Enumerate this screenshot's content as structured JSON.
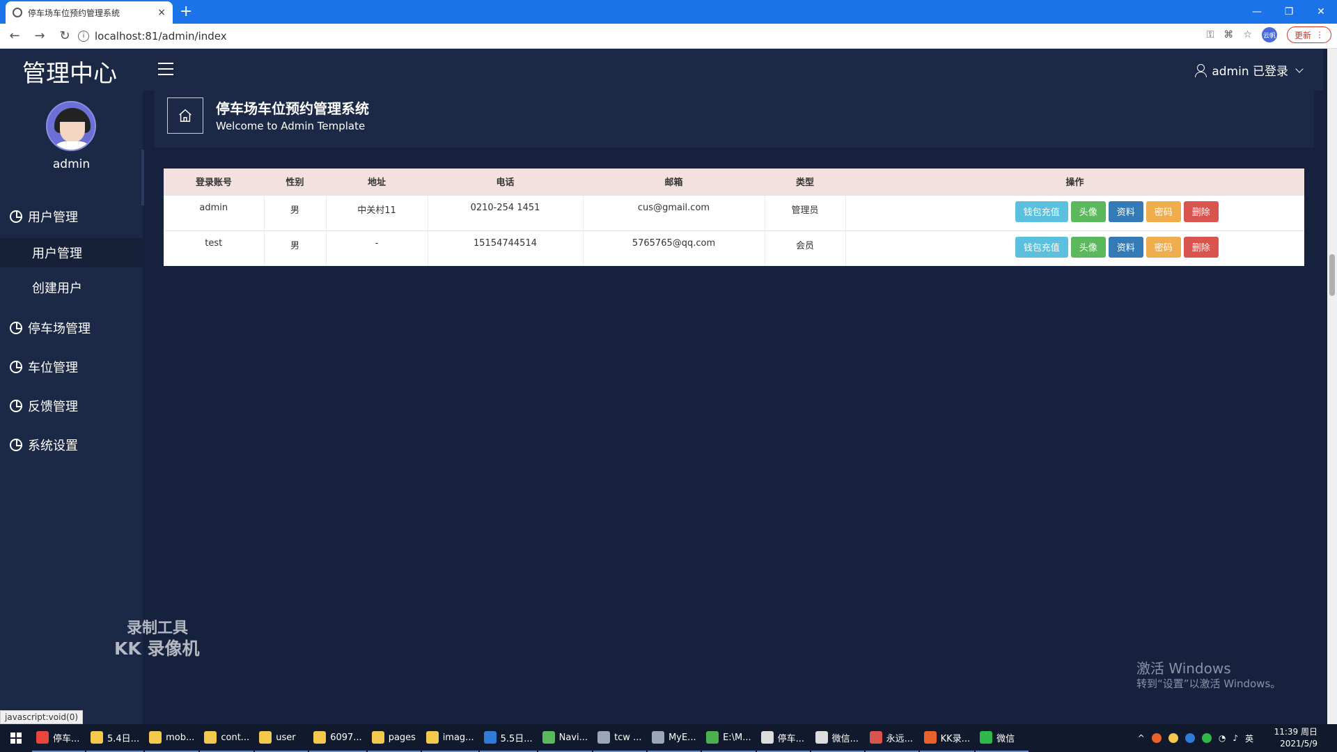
{
  "browser": {
    "tab_title": "停车场车位预约管理系统",
    "tab_close": "×",
    "new_tab": "+",
    "url": "localhost:81/admin/index",
    "update_label": "更新",
    "profile_label": "云帆",
    "status_url": "javascript:void(0)"
  },
  "sidebar": {
    "brand": "管理中心",
    "admin_name": "admin",
    "menu": [
      {
        "label": "用户管理"
      },
      {
        "label": "停车场管理"
      },
      {
        "label": "车位管理"
      },
      {
        "label": "反馈管理"
      },
      {
        "label": "系统设置"
      }
    ],
    "submenu": [
      {
        "label": "用户管理",
        "active": true
      },
      {
        "label": "创建用户",
        "active": false
      }
    ]
  },
  "header": {
    "user_label": "admin 已登录"
  },
  "page": {
    "title": "停车场车位预约管理系统",
    "subtitle": "Welcome to Admin Template"
  },
  "table": {
    "columns": [
      "登录账号",
      "性别",
      "地址",
      "电话",
      "邮箱",
      "类型",
      "操作"
    ],
    "rows": [
      {
        "account": "admin",
        "gender": "男",
        "address": "中关村11",
        "phone": "0210-254 1451",
        "email": "cus@gmail.com",
        "type": "管理员"
      },
      {
        "account": "test",
        "gender": "男",
        "address": "-",
        "phone": "15154744514",
        "email": "5765765@qq.com",
        "type": "会员"
      }
    ],
    "actions": {
      "recharge": "钱包充值",
      "avatar": "头像",
      "profile": "资料",
      "password": "密码",
      "delete": "删除"
    }
  },
  "watermark": {
    "line1": "录制工具",
    "line2": "KK 录像机"
  },
  "activation": {
    "line1": "激活 Windows",
    "line2": "转到“设置”以激活 Windows。"
  },
  "taskbar": {
    "items": [
      {
        "label": "停车...",
        "color": "#e8453c"
      },
      {
        "label": "5.4日...",
        "color": "#f2c94c"
      },
      {
        "label": "mob...",
        "color": "#f2c94c"
      },
      {
        "label": "cont...",
        "color": "#f2c94c"
      },
      {
        "label": "user",
        "color": "#f2c94c"
      },
      {
        "label": "6097...",
        "color": "#f2c94c"
      },
      {
        "label": "pages",
        "color": "#f2c94c"
      },
      {
        "label": "imag...",
        "color": "#f2c94c"
      },
      {
        "label": "5.5日...",
        "color": "#2f7bd8"
      },
      {
        "label": "Navi...",
        "color": "#5cb85c"
      },
      {
        "label": "tcw ...",
        "color": "#9aa7bb"
      },
      {
        "label": "MyE...",
        "color": "#9aa7bb"
      },
      {
        "label": "E:\\M...",
        "color": "#4caf50"
      },
      {
        "label": "停车...",
        "color": "#dddddd"
      },
      {
        "label": "微信...",
        "color": "#dddddd"
      },
      {
        "label": "永远...",
        "color": "#d9534f"
      },
      {
        "label": "KK录...",
        "color": "#e8632b"
      },
      {
        "label": "微信",
        "color": "#2fb84a"
      }
    ],
    "input_method": "英",
    "time": "11:39 周日",
    "date": "2021/5/9"
  }
}
